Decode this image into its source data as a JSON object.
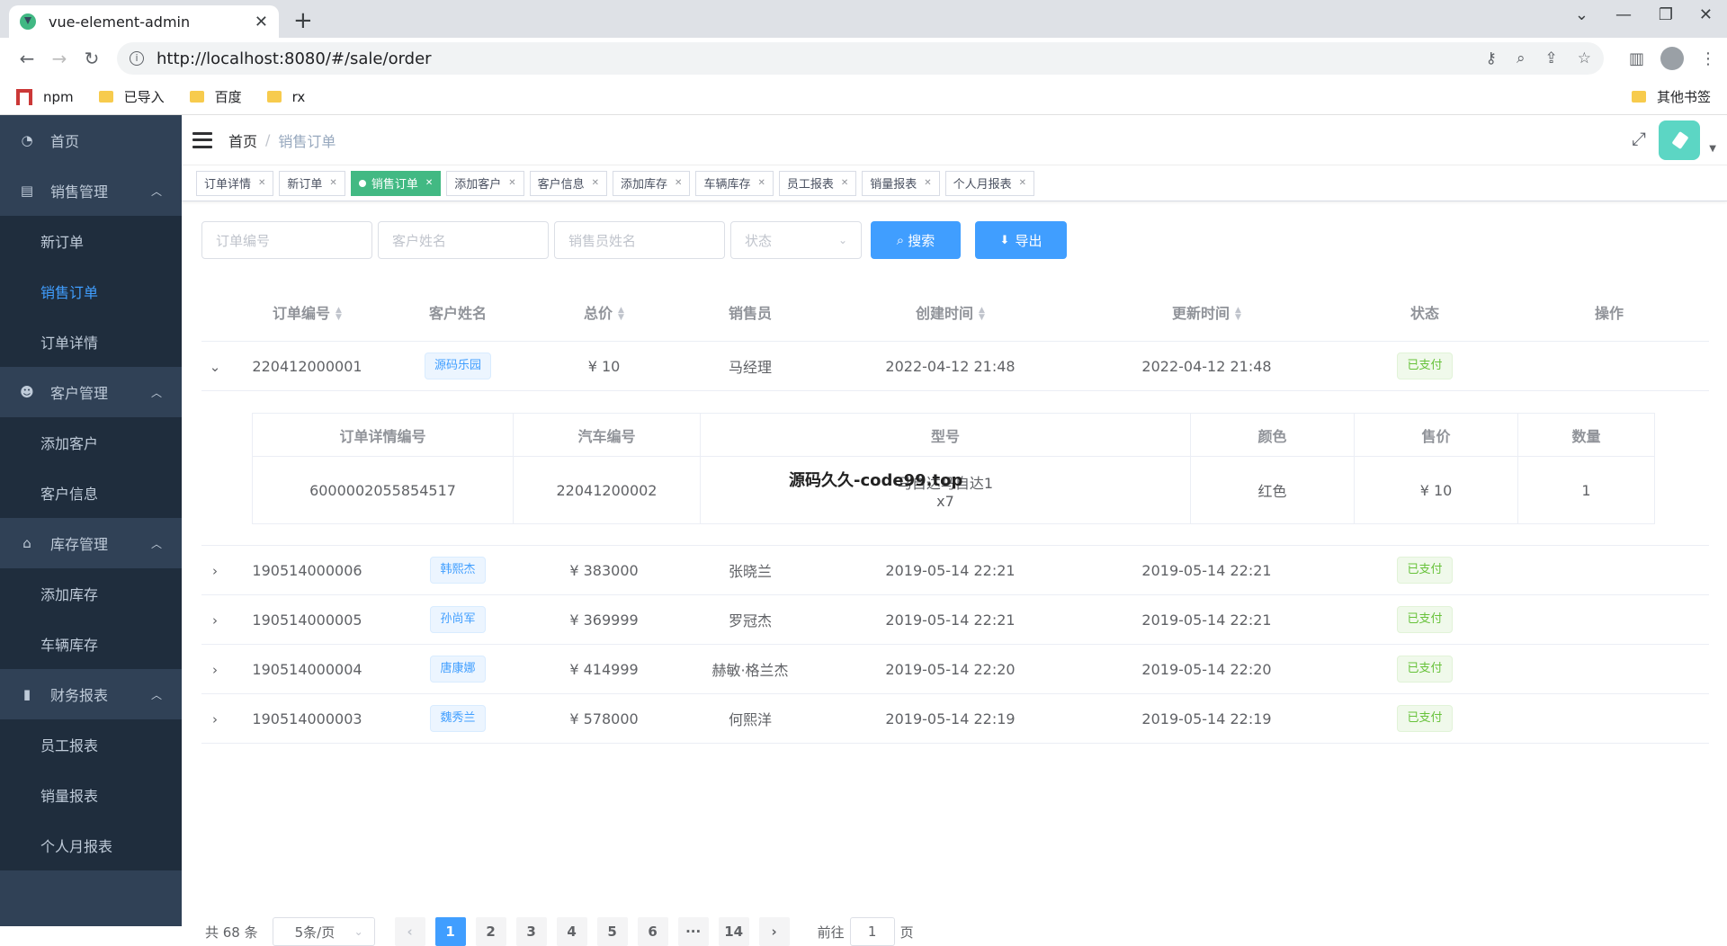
{
  "browser": {
    "tab_title": "vue-element-admin",
    "url": "http://localhost:8080/#/sale/order",
    "bookmarks": [
      "npm",
      "已导入",
      "百度",
      "rx"
    ],
    "other_bookmarks": "其他书签"
  },
  "sidebar": {
    "home": "首页",
    "groups": [
      {
        "label": "销售管理",
        "icon": "document-icon",
        "items": [
          "新订单",
          "销售订单",
          "订单详情"
        ]
      },
      {
        "label": "客户管理",
        "icon": "users-icon",
        "items": [
          "添加客户",
          "客户信息"
        ]
      },
      {
        "label": "库存管理",
        "icon": "home-icon",
        "items": [
          "添加库存",
          "车辆库存"
        ]
      },
      {
        "label": "财务报表",
        "icon": "bar-chart-icon",
        "items": [
          "员工报表",
          "销量报表",
          "个人月报表"
        ]
      }
    ],
    "active_item": "销售订单"
  },
  "breadcrumb": {
    "home": "首页",
    "current": "销售订单"
  },
  "tags": [
    "订单详情",
    "新订单",
    "销售订单",
    "添加客户",
    "客户信息",
    "添加库存",
    "车辆库存",
    "员工报表",
    "销量报表",
    "个人月报表"
  ],
  "active_tag": "销售订单",
  "filters": {
    "order_no_placeholder": "订单编号",
    "customer_placeholder": "客户姓名",
    "salesman_placeholder": "销售员姓名",
    "status_placeholder": "状态",
    "search_label": "搜索",
    "export_label": "导出"
  },
  "table": {
    "headers": [
      "订单编号",
      "客户姓名",
      "总价",
      "销售员",
      "创建时间",
      "更新时间",
      "状态",
      "操作"
    ],
    "rows": [
      {
        "order_no": "220412000001",
        "customer": "源码乐园",
        "total": "¥ 10",
        "salesman": "马经理",
        "created": "2022-04-12 21:48",
        "updated": "2022-04-12 21:48",
        "status": "已支付",
        "expanded": true
      },
      {
        "order_no": "190514000006",
        "customer": "韩熙杰",
        "total": "¥ 383000",
        "salesman": "张晓兰",
        "created": "2019-05-14 22:21",
        "updated": "2019-05-14 22:21",
        "status": "已支付",
        "expanded": false
      },
      {
        "order_no": "190514000005",
        "customer": "孙尚军",
        "total": "¥ 369999",
        "salesman": "罗冠杰",
        "created": "2019-05-14 22:21",
        "updated": "2019-05-14 22:21",
        "status": "已支付",
        "expanded": false
      },
      {
        "order_no": "190514000004",
        "customer": "唐康娜",
        "total": "¥ 414999",
        "salesman": "赫敏·格兰杰",
        "created": "2019-05-14 22:20",
        "updated": "2019-05-14 22:20",
        "status": "已支付",
        "expanded": false
      },
      {
        "order_no": "190514000003",
        "customer": "魏秀兰",
        "total": "¥ 578000",
        "salesman": "何熙洋",
        "created": "2019-05-14 22:19",
        "updated": "2019-05-14 22:19",
        "status": "已支付",
        "expanded": false
      }
    ]
  },
  "detail": {
    "headers": [
      "订单详情编号",
      "汽车编号",
      "型号",
      "颜色",
      "售价",
      "数量"
    ],
    "row": {
      "detail_no": "6000002055854517",
      "car_no": "22041200002",
      "model_line1": "马自达马自达1",
      "model_line2": "x7",
      "color": "红色",
      "price": "¥ 10",
      "qty": "1"
    }
  },
  "watermark": "源码久久-code99.top",
  "pagination": {
    "total": "共 68 条",
    "page_size": "5条/页",
    "pages": [
      "1",
      "2",
      "3",
      "4",
      "5",
      "6",
      "···",
      "14"
    ],
    "current": "1",
    "goto_prefix": "前往",
    "goto_value": "1",
    "goto_suffix": "页"
  }
}
